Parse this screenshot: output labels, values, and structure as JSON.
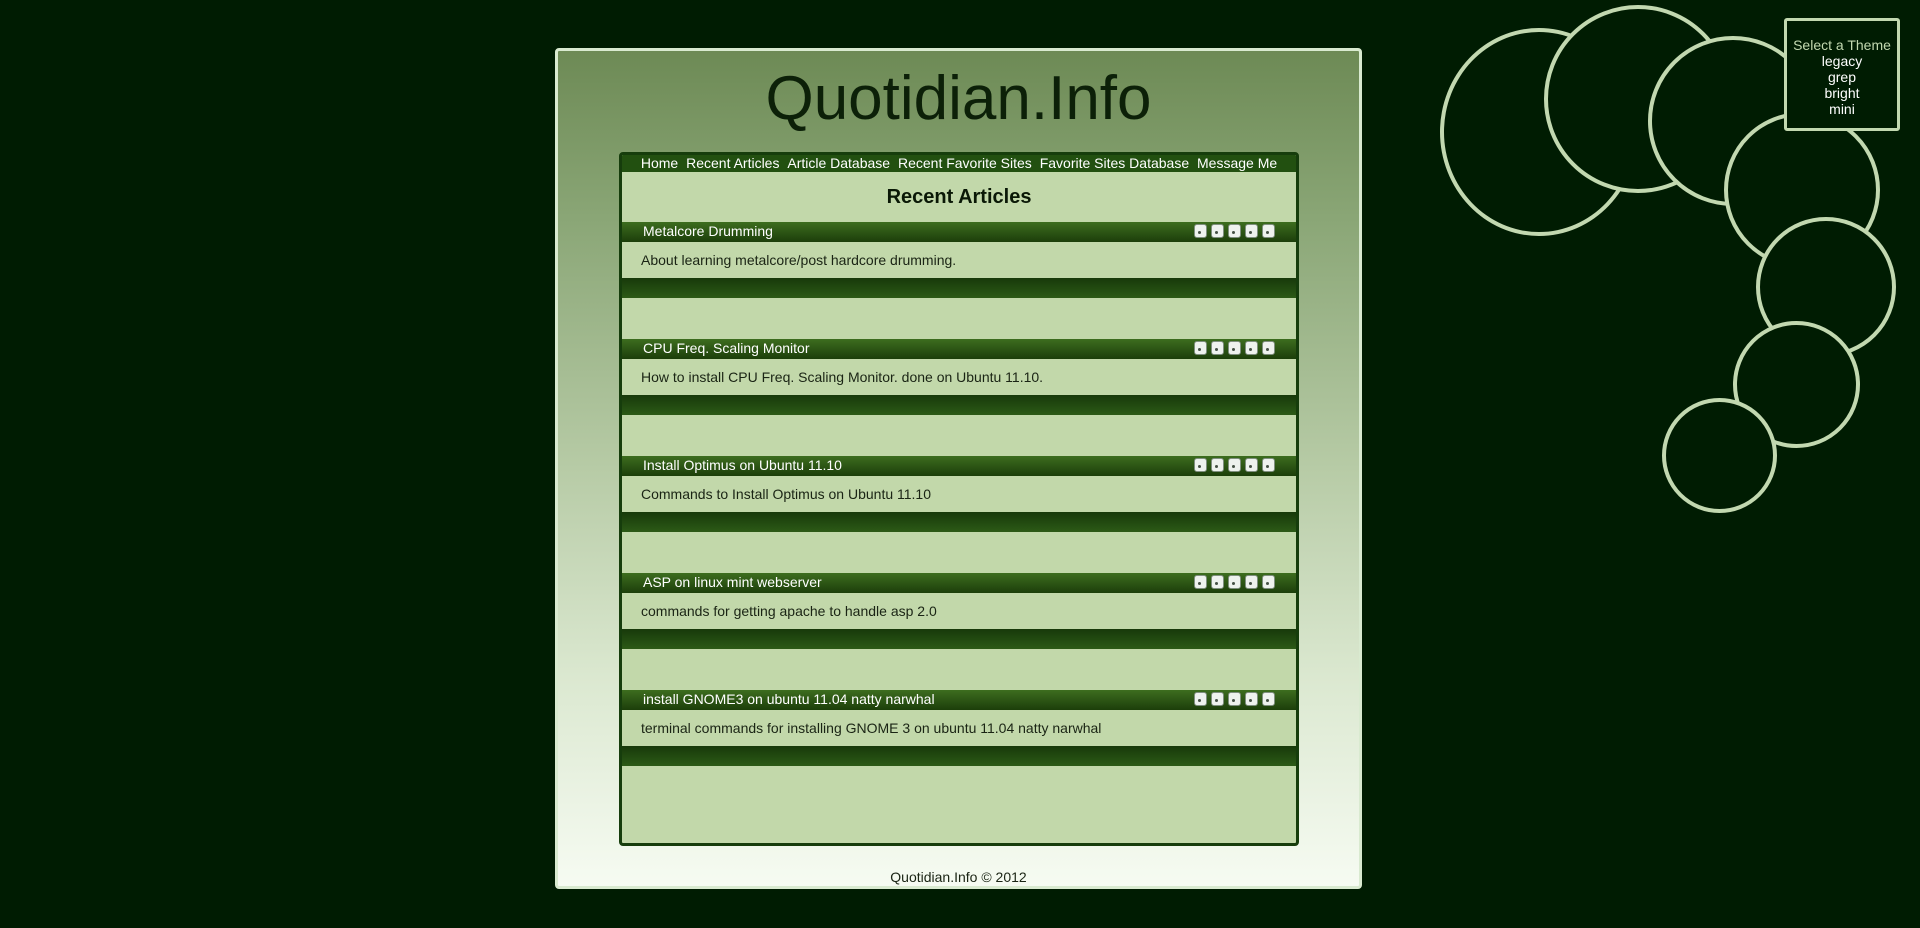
{
  "theme_selector": {
    "title": "Select a Theme",
    "options": [
      "legacy",
      "grep",
      "bright",
      "mini"
    ]
  },
  "site": {
    "title": "Quotidian.Info",
    "footer": "Quotidian.Info © 2012"
  },
  "nav": {
    "items": [
      "Home",
      "Recent Articles",
      "Article Database",
      "Recent Favorite Sites",
      "Favorite Sites Database",
      "Message Me"
    ]
  },
  "main": {
    "section_title": "Recent Articles",
    "articles": [
      {
        "title": "Metalcore Drumming",
        "description": "About learning metalcore/post hardcore drumming."
      },
      {
        "title": "CPU Freq. Scaling Monitor",
        "description": "How to install CPU Freq. Scaling Monitor. done on Ubuntu 11.10."
      },
      {
        "title": "Install Optimus on Ubuntu 11.10",
        "description": "Commands to Install Optimus on Ubuntu 11.10"
      },
      {
        "title": "ASP on linux mint webserver",
        "description": "commands for getting apache to handle asp 2.0"
      },
      {
        "title": "install GNOME3 on ubuntu 11.04 natty narwhal",
        "description": "terminal commands for installing GNOME 3 on ubuntu 11.04 natty narwhal"
      }
    ]
  },
  "colors": {
    "background": "#001c02",
    "accent_light": "#c2d8b0",
    "nav_bar": "#225010",
    "content_panel": "#c2d8aa"
  }
}
